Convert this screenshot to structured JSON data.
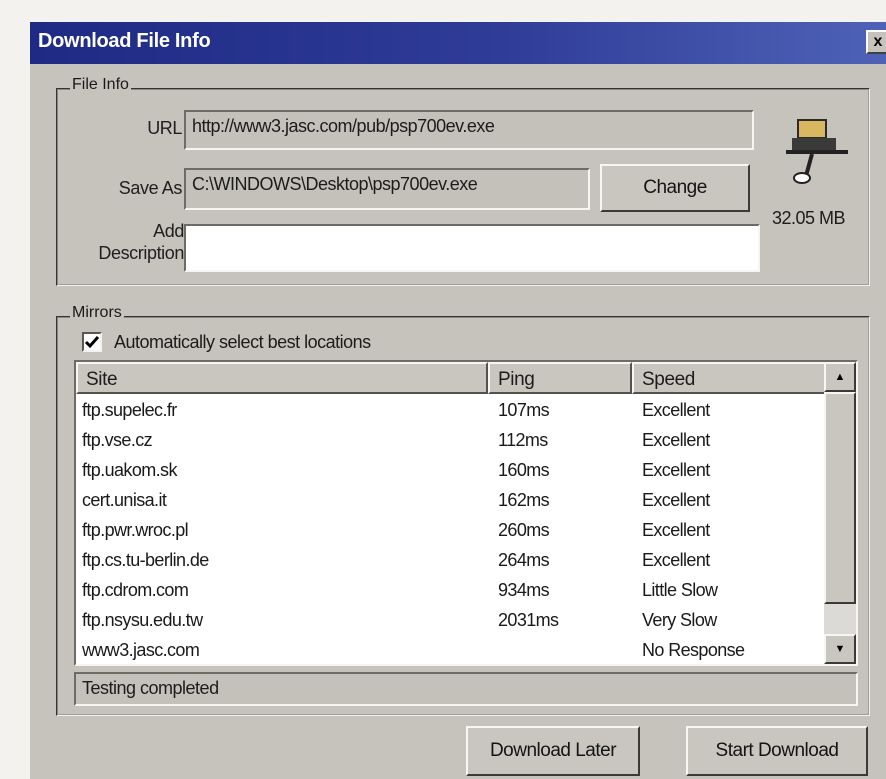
{
  "window": {
    "title": "Download File Info",
    "close_symbol": "x"
  },
  "file_info": {
    "group_label": "File Info",
    "url_label": "URL",
    "url_value": "http://www3.jasc.com/pub/psp700ev.exe",
    "save_as_label": "Save As",
    "save_as_value": "C:\\WINDOWS\\Desktop\\psp700ev.exe",
    "change_button": "Change",
    "description_label_line1": "Add",
    "description_label_line2": "Description",
    "description_value": "",
    "file_size": "32.05 MB",
    "icon": "drive-download-icon"
  },
  "mirrors": {
    "group_label": "Mirrors",
    "auto_select_label": "Automatically select best locations",
    "auto_select_checked": true,
    "columns": {
      "site": "Site",
      "ping": "Ping",
      "speed": "Speed"
    },
    "rows": [
      {
        "site": "ftp.supelec.fr",
        "ping": "107ms",
        "speed": "Excellent"
      },
      {
        "site": "ftp.vse.cz",
        "ping": "112ms",
        "speed": "Excellent"
      },
      {
        "site": "ftp.uakom.sk",
        "ping": "160ms",
        "speed": "Excellent"
      },
      {
        "site": "cert.unisa.it",
        "ping": "162ms",
        "speed": "Excellent"
      },
      {
        "site": "ftp.pwr.wroc.pl",
        "ping": "260ms",
        "speed": "Excellent"
      },
      {
        "site": "ftp.cs.tu-berlin.de",
        "ping": "264ms",
        "speed": "Excellent"
      },
      {
        "site": "ftp.cdrom.com",
        "ping": "934ms",
        "speed": "Little Slow"
      },
      {
        "site": "ftp.nsysu.edu.tw",
        "ping": "2031ms",
        "speed": "Very Slow"
      },
      {
        "site": "www3.jasc.com",
        "ping": "",
        "speed": "No Response"
      }
    ],
    "status": "Testing completed"
  },
  "footer": {
    "download_later": "Download Later",
    "start_download": "Start Download"
  },
  "colors": {
    "title_bar": "#1e2a84",
    "dialog_face": "#c6c3bd"
  }
}
